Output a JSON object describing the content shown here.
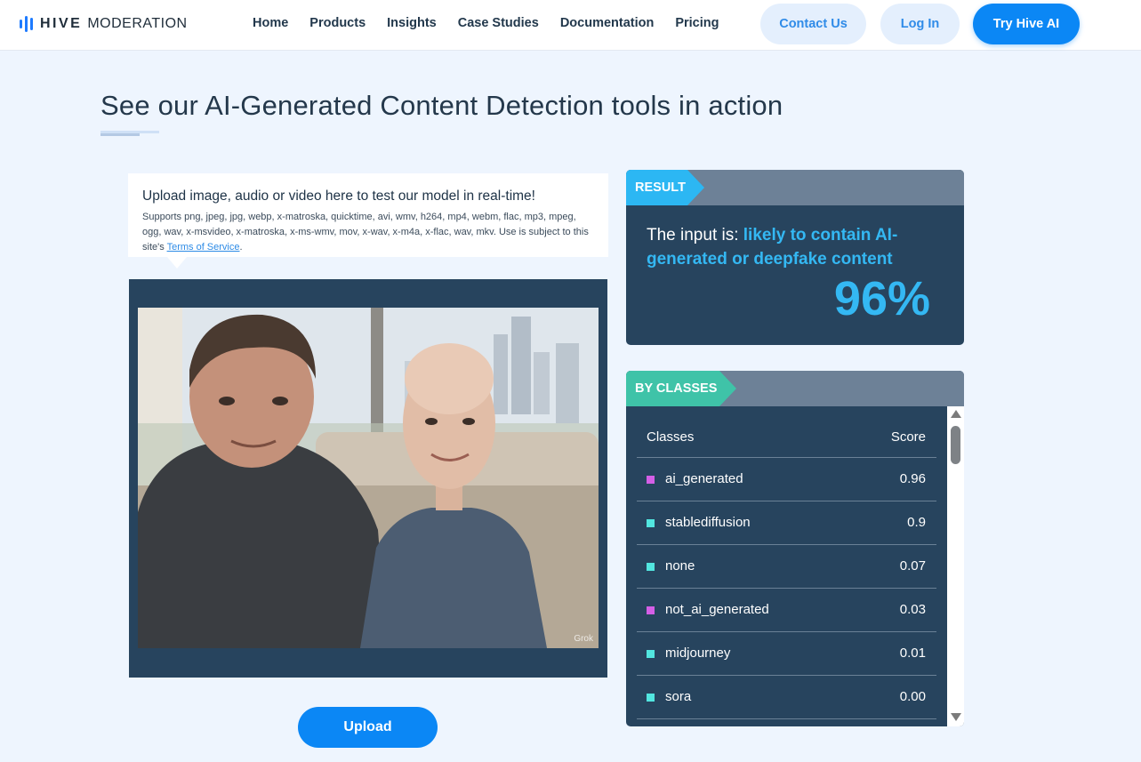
{
  "header": {
    "logo_bold": "HIVE",
    "logo_light": "MODERATION",
    "nav": [
      "Home",
      "Products",
      "Insights",
      "Case Studies",
      "Documentation",
      "Pricing"
    ],
    "contact_label": "Contact Us",
    "login_label": "Log In",
    "try_label": "Try Hive AI"
  },
  "page": {
    "title": "See our AI-Generated Content Detection tools in action"
  },
  "upload": {
    "headline": "Upload image, audio or video here to test our model in real-time!",
    "formats": "Supports png, jpeg, jpg, webp, x-matroska, quicktime, avi, wmv, h264, mp4, webm, flac, mp3, mpeg, ogg, wav, x-msvideo, x-matroska, x-ms-wmv, mov, x-wav, x-m4a, x-flac, wav, mkv. Use is subject to this site's ",
    "tos_link": "Terms of Service",
    "formats_end": ".",
    "watermark": "Grok",
    "button": "Upload"
  },
  "result": {
    "tag": "RESULT",
    "prefix": "The input is: ",
    "verdict": "likely to contain AI-generated or deepfake content",
    "percent": "96%"
  },
  "classes": {
    "tag": "BY CLASSES",
    "col_class": "Classes",
    "col_score": "Score",
    "rows": [
      {
        "name": "ai_generated",
        "score": "0.96",
        "color": "#d45fe6"
      },
      {
        "name": "stablediffusion",
        "score": "0.9",
        "color": "#52e6e0"
      },
      {
        "name": "none",
        "score": "0.07",
        "color": "#52e6e0"
      },
      {
        "name": "not_ai_generated",
        "score": "0.03",
        "color": "#d45fe6"
      },
      {
        "name": "midjourney",
        "score": "0.01",
        "color": "#52e6e0"
      },
      {
        "name": "sora",
        "score": "0.00",
        "color": "#52e6e0"
      }
    ]
  },
  "colors": {
    "accent_blue": "#0b87f5",
    "result_blue": "#34b8f3",
    "panel_navy": "#27445e",
    "classes_teal": "#3fc3a8"
  }
}
